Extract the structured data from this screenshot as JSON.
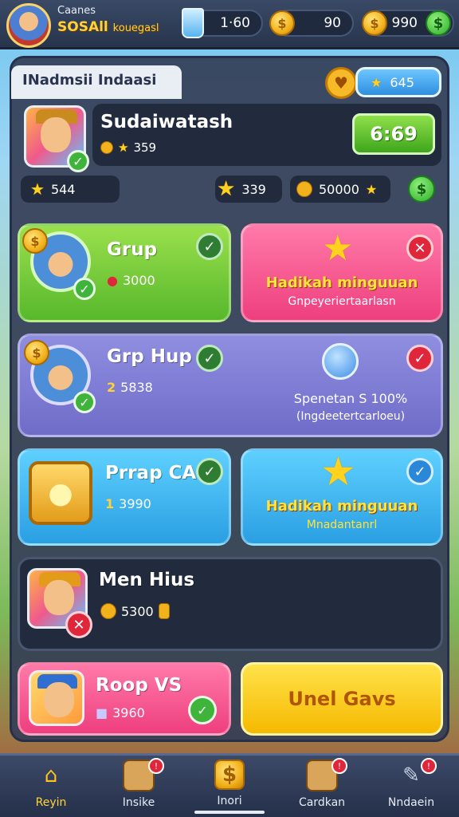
{
  "header": {
    "brand_small": "Caanes",
    "brand_big": "SOSAll",
    "brand_suffix": "kouegasl",
    "water_value": "1·60",
    "coins_value": "90",
    "cash_value": "990"
  },
  "panel": {
    "tab_title": "INadmsii Indaasi",
    "stars_badge": "645"
  },
  "profile": {
    "name": "Sudaiwatash",
    "stat_value": "359",
    "timer_button": "6:69",
    "stars_left": "544",
    "stars_mid": "339",
    "coins_total": "50000"
  },
  "cards": [
    {
      "title": "Grup",
      "value": "3000"
    },
    {
      "title": "Hadikah minguuan",
      "subtitle": "Gnpeyeriertaarlasn"
    },
    {
      "title": "Grp Hup",
      "value": "5838",
      "value_prefix": "2"
    },
    {
      "title": "Spenetan S 100%",
      "subtitle": "(Ingdeetertcarloeu)"
    },
    {
      "title": "Prrap CA",
      "value": "3990",
      "value_prefix": "1"
    },
    {
      "title": "Hadikah minguuan",
      "subtitle": "Mnadantanrl"
    },
    {
      "title": "Men Hius",
      "value": "5300"
    },
    {
      "title": "Roop VS",
      "value": "3960"
    },
    {
      "title": "Unel Gavs"
    }
  ],
  "nav": [
    {
      "label": "Reyin",
      "icon": "home-icon",
      "active": true
    },
    {
      "label": "Insike",
      "icon": "box-icon",
      "badge": true
    },
    {
      "label": "Inori",
      "icon": "coin-icon"
    },
    {
      "label": "Cardkan",
      "icon": "chest-icon",
      "badge": true
    },
    {
      "label": "Nndaein",
      "icon": "wrench-icon",
      "badge": true
    }
  ],
  "colors": {
    "accent_yellow": "#ffd23a",
    "green": "#57b82b",
    "pink": "#ee3f7e",
    "purple": "#6f6cc8",
    "blue": "#2a9fe2"
  }
}
